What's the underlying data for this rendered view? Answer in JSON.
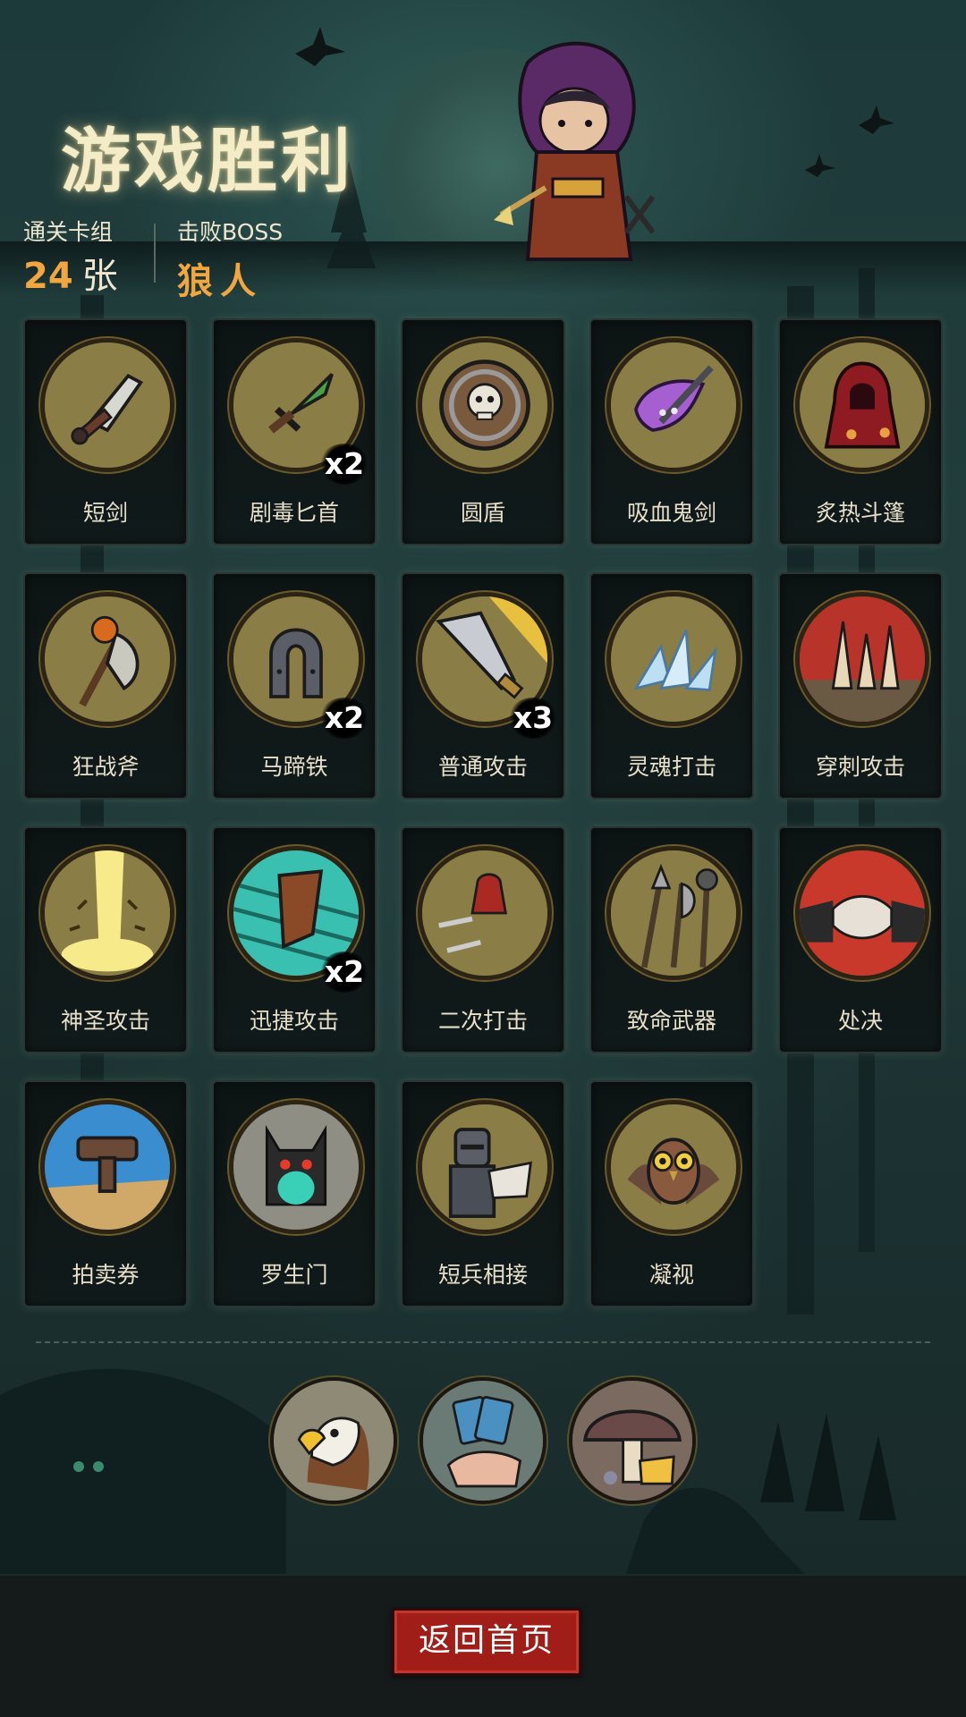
{
  "header": {
    "title": "游戏胜利",
    "stats": [
      {
        "label": "通关卡组",
        "value": "24",
        "unit": "张"
      },
      {
        "label": "击败BOSS",
        "value": "狼人",
        "unit": ""
      }
    ]
  },
  "cards": [
    {
      "name": "短剑",
      "count": "",
      "icon": "short-sword-icon"
    },
    {
      "name": "剧毒匕首",
      "count": "x2",
      "icon": "poison-dagger-icon"
    },
    {
      "name": "圆盾",
      "count": "",
      "icon": "round-shield-icon"
    },
    {
      "name": "吸血鬼剑",
      "count": "",
      "icon": "vampire-sword-icon"
    },
    {
      "name": "炙热斗篷",
      "count": "",
      "icon": "red-cloak-icon"
    },
    {
      "name": "狂战斧",
      "count": "",
      "icon": "battle-axe-icon"
    },
    {
      "name": "马蹄铁",
      "count": "x2",
      "icon": "horseshoe-icon"
    },
    {
      "name": "普通攻击",
      "count": "x3",
      "icon": "sword-strike-icon"
    },
    {
      "name": "灵魂打击",
      "count": "",
      "icon": "ice-crystal-icon"
    },
    {
      "name": "穿刺攻击",
      "count": "",
      "icon": "spikes-icon"
    },
    {
      "name": "神圣攻击",
      "count": "",
      "icon": "holy-light-icon"
    },
    {
      "name": "迅捷攻击",
      "count": "x2",
      "icon": "swift-strike-icon"
    },
    {
      "name": "二次打击",
      "count": "",
      "icon": "double-strike-icon"
    },
    {
      "name": "致命武器",
      "count": "",
      "icon": "weapons-icon"
    },
    {
      "name": "处决",
      "count": "",
      "icon": "execution-icon"
    },
    {
      "name": "拍卖券",
      "count": "",
      "icon": "auction-gavel-icon"
    },
    {
      "name": "罗生门",
      "count": "",
      "icon": "demon-gate-icon"
    },
    {
      "name": "短兵相接",
      "count": "",
      "icon": "knight-icon"
    },
    {
      "name": "凝视",
      "count": "",
      "icon": "owl-icon"
    }
  ],
  "relics": [
    {
      "icon": "eagle-icon"
    },
    {
      "icon": "card-hand-icon"
    },
    {
      "icon": "mushroom-cheese-icon"
    }
  ],
  "footer": {
    "home_label": "返回首页"
  },
  "colors": {
    "accent": "#f2a640",
    "button": "#a01d18",
    "medal": "#8a7d45"
  }
}
